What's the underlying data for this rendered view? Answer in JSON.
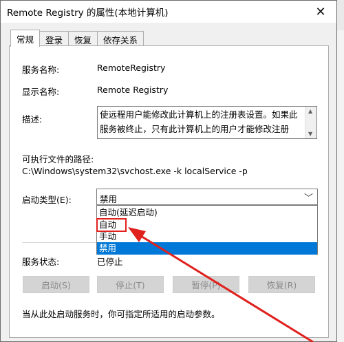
{
  "window": {
    "title": "Remote Registry 的属性(本地计算机)",
    "close_glyph": "✕"
  },
  "tabs": [
    {
      "label": "常规",
      "active": true
    },
    {
      "label": "登录",
      "active": false
    },
    {
      "label": "恢复",
      "active": false
    },
    {
      "label": "依存关系",
      "active": false
    }
  ],
  "general": {
    "service_name_label": "服务名称:",
    "service_name_value": "RemoteRegistry",
    "display_name_label": "显示名称:",
    "display_name_value": "Remote Registry",
    "description_label": "描述:",
    "description_text": "使远程用户能修改此计算机上的注册表设置。如果此服务被终止，只有此计算机上的用户才能修改注册表。如果此服务被禁用，任何依赖它的服务将无法启动。",
    "exe_path_label": "可执行文件的路径:",
    "exe_path_value": "C:\\Windows\\system32\\svchost.exe -k localService -p",
    "startup_type_label": "启动类型(E):",
    "startup_type_value": "禁用",
    "startup_options": [
      "自动(延迟启动)",
      "自动",
      "手动",
      "禁用"
    ],
    "startup_selected_option": "禁用",
    "startup_highlighted_option": "自动",
    "status_label": "服务状态:",
    "status_value": "已停止",
    "hint_text": "当从此处启动服务时，你可指定所适用的启动参数。"
  },
  "buttons": {
    "start": "启动(S)",
    "stop": "停止(T)",
    "pause": "暂停(P)",
    "resume": "恢复(R)"
  },
  "colors": {
    "selection": "#0078d7",
    "annotation_red": "#e0211d"
  },
  "icons": {
    "close": "close-icon",
    "dropdown": "chevron-down-icon",
    "scroll_up": "scroll-up-arrow-icon",
    "scroll_down": "scroll-down-arrow-icon",
    "annotation": "red-arrow-annotation"
  }
}
